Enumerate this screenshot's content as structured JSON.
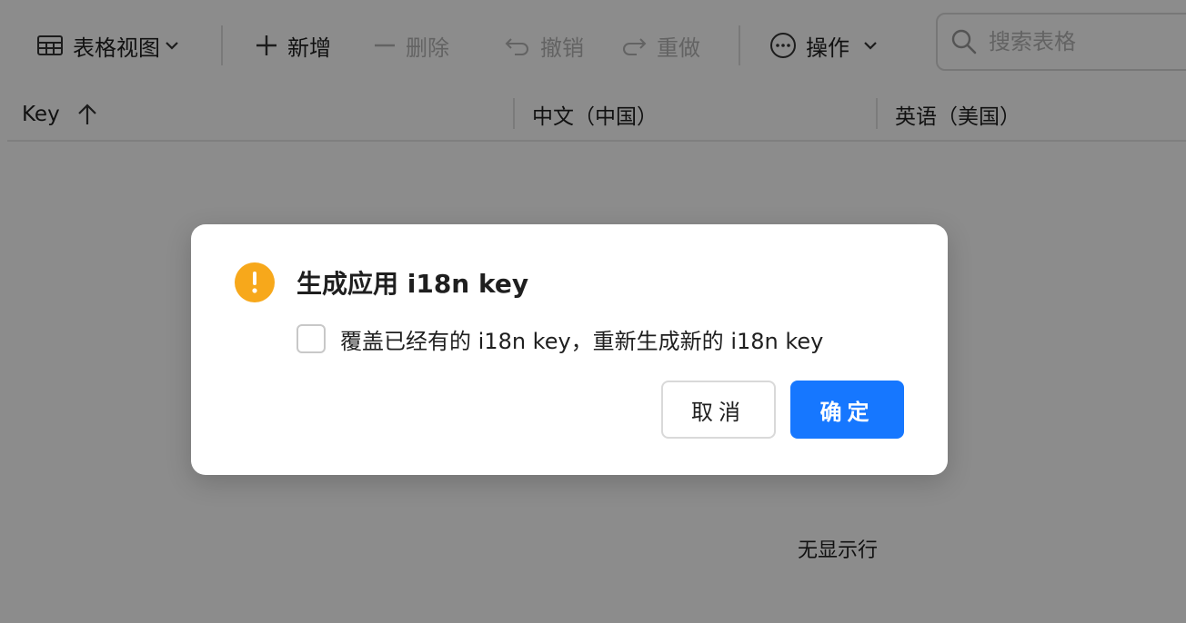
{
  "toolbar": {
    "view_label": "表格视图",
    "add_label": "新增",
    "delete_label": "删除",
    "undo_label": "撤销",
    "redo_label": "重做",
    "actions_label": "操作",
    "search_placeholder": "搜索表格"
  },
  "table": {
    "columns": [
      {
        "label": "Key",
        "sort": "ascending"
      },
      {
        "label": "中文（中国）"
      },
      {
        "label": "英语（美国）"
      }
    ],
    "empty_text": "无显示行"
  },
  "dialog": {
    "title": "生成应用 i18n key",
    "checkbox_label": "覆盖已经有的 i18n key，重新生成新的 i18n key",
    "checkbox_checked": false,
    "cancel_label": "取消",
    "ok_label": "确定",
    "icon": "warning-icon"
  },
  "colors": {
    "primary": "#1677ff",
    "warning": "#f7a81b",
    "overlay": "rgba(0,0,0,0.45)"
  }
}
